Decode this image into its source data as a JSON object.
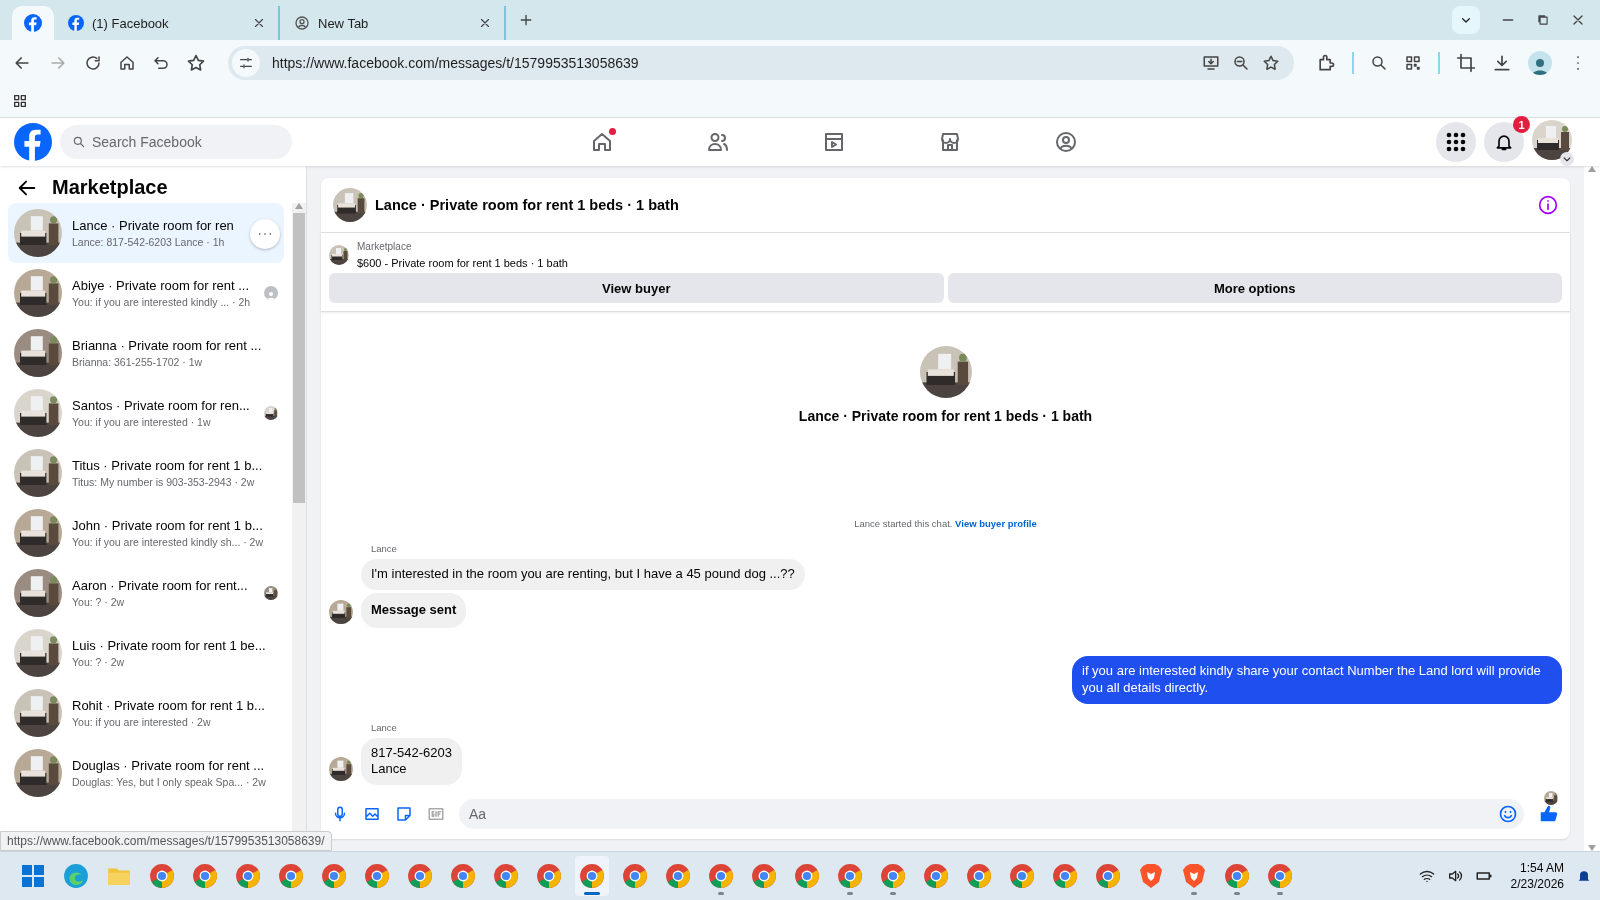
{
  "browser": {
    "tabs": [
      {
        "kind": "pinned",
        "selected": true
      },
      {
        "kind": "page",
        "title": "(1) Facebook",
        "selected": false
      },
      {
        "kind": "page",
        "title": "New Tab",
        "selected": false
      }
    ],
    "url": "https://www.facebook.com/messages/t/1579953513058639"
  },
  "facebook": {
    "search": {
      "placeholder": "Search Facebook"
    },
    "nav": [
      {
        "kind": "home",
        "dot": true
      },
      {
        "kind": "friends",
        "dot": false
      },
      {
        "kind": "video",
        "dot": false
      },
      {
        "kind": "marketplace",
        "dot": false
      },
      {
        "kind": "groups",
        "dot": false
      }
    ],
    "notification_count": "1"
  },
  "sidebar": {
    "title": "Marketplace",
    "conversations": [
      {
        "title": "Lance · Private room for ren",
        "preview": "Lance: 817-542-6203 Lance · 1h",
        "selected": true,
        "menu": true,
        "seen_photo": false,
        "unseen_icon": false
      },
      {
        "title": "Abiye · Private room for rent ...",
        "preview": "You: if you are interested kindly ... · 2h",
        "selected": false,
        "menu": false,
        "seen_photo": false,
        "unseen_icon": true
      },
      {
        "title": "Brianna · Private room for rent ...",
        "preview": "Brianna: 361-255-1702 · 1w",
        "selected": false,
        "menu": false,
        "seen_photo": false,
        "unseen_icon": false
      },
      {
        "title": "Santos · Private room for ren...",
        "preview": "You: if you are interested · 1w",
        "selected": false,
        "menu": false,
        "seen_photo": true,
        "unseen_icon": false
      },
      {
        "title": "Titus · Private room for rent 1 b...",
        "preview": "Titus: My number is 903-353-2943 · 2w",
        "selected": false,
        "menu": false,
        "seen_photo": false,
        "unseen_icon": false
      },
      {
        "title": "John · Private room for rent 1 b...",
        "preview": "You: if you are interested kindly sh... · 2w",
        "selected": false,
        "menu": false,
        "seen_photo": false,
        "unseen_icon": false
      },
      {
        "title": "Aaron · Private room for rent...",
        "preview": "You: ? · 2w",
        "selected": false,
        "menu": false,
        "seen_photo": true,
        "unseen_icon": false
      },
      {
        "title": "Luis · Private room for rent 1 be...",
        "preview": "You: ? · 2w",
        "selected": false,
        "menu": false,
        "seen_photo": false,
        "unseen_icon": false
      },
      {
        "title": "Rohit · Private room for rent 1 b...",
        "preview": "You: if you are interested · 2w",
        "selected": false,
        "menu": false,
        "seen_photo": false,
        "unseen_icon": false
      },
      {
        "title": "Douglas · Private room for rent ...",
        "preview": "Douglas: Yes, but I only speak Spa... · 2w",
        "selected": false,
        "menu": false,
        "seen_photo": false,
        "unseen_icon": false
      }
    ]
  },
  "chat": {
    "title": "Lance · Private room for rent 1 beds · 1 bath",
    "listing": {
      "label": "Marketplace",
      "summary": "$600 - Private room for rent 1 beds · 1 bath",
      "buttons": [
        "View buyer",
        "More options"
      ]
    },
    "intro_title": "Lance · Private room for rent 1 beds · 1 bath",
    "notice": "Lance started this chat.",
    "notice_link": "View buyer profile",
    "groups": [
      {
        "kind": "incoming",
        "sender": "Lance",
        "messages": [
          {
            "text": "I'm interested in the room you are renting, but I have a 45 pound dog ...??",
            "bold": false
          },
          {
            "text": "Message sent",
            "bold": true
          }
        ]
      },
      {
        "kind": "outgoing",
        "messages": [
          {
            "text": "if you are interested kindly share your contact Number the Land lord will provide you all details directly.",
            "bold": false
          }
        ]
      },
      {
        "kind": "incoming",
        "sender": "Lance",
        "messages": [
          {
            "text": "817-542-6203\nLance",
            "bold": false
          }
        ]
      }
    ],
    "composer": {
      "placeholder": "Aa"
    }
  },
  "status_url": "https://www.facebook.com/messages/t/1579953513058639/",
  "taskbar": {
    "apps": [
      {
        "kind": "start",
        "running": false,
        "selected": false
      },
      {
        "kind": "edge",
        "running": false,
        "selected": false
      },
      {
        "kind": "folder",
        "running": false,
        "selected": false
      },
      {
        "kind": "chrome",
        "running": false,
        "selected": false
      },
      {
        "kind": "chrome",
        "running": false,
        "selected": false
      },
      {
        "kind": "chrome",
        "running": false,
        "selected": false
      },
      {
        "kind": "chrome",
        "running": false,
        "selected": false
      },
      {
        "kind": "chrome",
        "running": false,
        "selected": false
      },
      {
        "kind": "chrome",
        "running": false,
        "selected": false
      },
      {
        "kind": "chrome",
        "running": false,
        "selected": false
      },
      {
        "kind": "chrome",
        "running": false,
        "selected": false
      },
      {
        "kind": "chrome",
        "running": false,
        "selected": false
      },
      {
        "kind": "chrome",
        "running": false,
        "selected": false
      },
      {
        "kind": "chrome",
        "running": true,
        "selected": true
      },
      {
        "kind": "chrome",
        "running": false,
        "selected": false
      },
      {
        "kind": "chrome",
        "running": false,
        "selected": false
      },
      {
        "kind": "chrome",
        "running": true,
        "selected": false
      },
      {
        "kind": "chrome",
        "running": false,
        "selected": false
      },
      {
        "kind": "chrome",
        "running": false,
        "selected": false
      },
      {
        "kind": "chrome",
        "running": true,
        "selected": false
      },
      {
        "kind": "chrome",
        "running": true,
        "selected": false
      },
      {
        "kind": "chrome",
        "running": false,
        "selected": false
      },
      {
        "kind": "chrome",
        "running": false,
        "selected": false
      },
      {
        "kind": "chrome",
        "running": false,
        "selected": false
      },
      {
        "kind": "chrome",
        "running": false,
        "selected": false
      },
      {
        "kind": "chrome",
        "running": false,
        "selected": false
      },
      {
        "kind": "brave",
        "running": false,
        "selected": false
      },
      {
        "kind": "brave",
        "running": true,
        "selected": false
      },
      {
        "kind": "chrome",
        "running": true,
        "selected": false
      },
      {
        "kind": "chrome",
        "running": true,
        "selected": false
      }
    ],
    "time": "1:54 AM",
    "date": "2/23/2026"
  }
}
